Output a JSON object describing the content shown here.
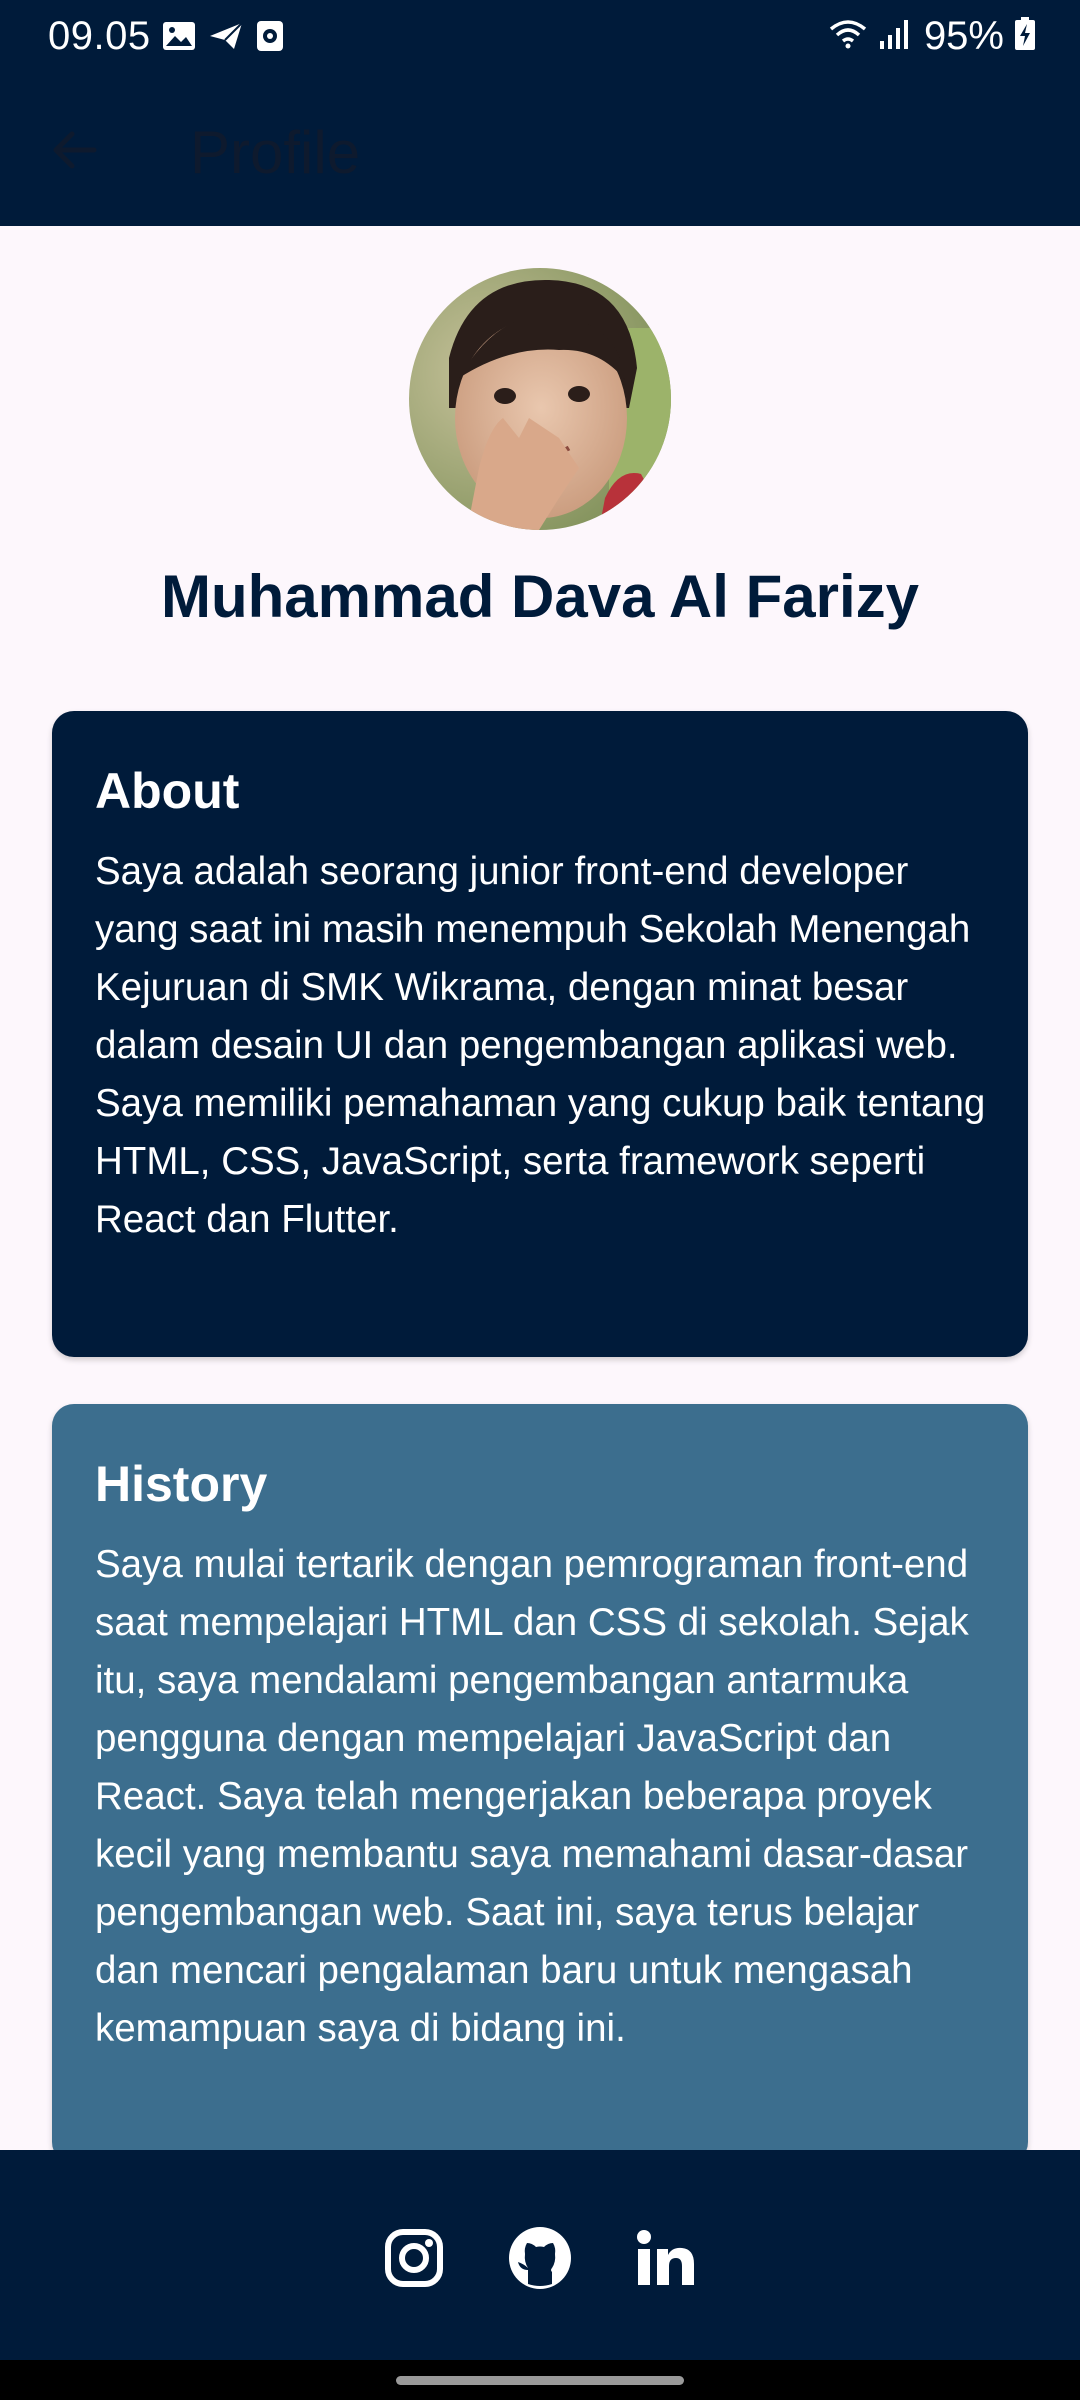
{
  "status_bar": {
    "time": "09.05",
    "battery": "95%",
    "left_icons": [
      "gallery-icon",
      "send-icon",
      "screen-record-icon"
    ],
    "right_icons": [
      "wifi-icon",
      "signal-icon",
      "battery-charging-icon"
    ]
  },
  "app_bar": {
    "title": "Profile",
    "back_icon": "arrow-back-icon"
  },
  "profile": {
    "name": "Muhammad Dava Al Farizy"
  },
  "cards": {
    "about": {
      "title": "About",
      "body": "Saya adalah seorang junior front-end developer yang saat ini masih menempuh Sekolah Menengah Kejuruan di SMK Wikrama, dengan minat besar dalam desain UI dan pengembangan aplikasi web. Saya memiliki pemahaman yang cukup baik tentang HTML, CSS, JavaScript, serta framework seperti React dan Flutter."
    },
    "history": {
      "title": "History",
      "body": "Saya mulai tertarik dengan pemrograman front-end saat mempelajari HTML dan CSS di sekolah. Sejak itu, saya mendalami pengembangan antarmuka pengguna dengan mempelajari JavaScript dan React. Saya telah mengerjakan beberapa proyek kecil yang membantu saya memahami dasar-dasar pengembangan web. Saat ini, saya terus belajar dan mencari pengalaman baru untuk mengasah kemampuan saya di bidang ini."
    }
  },
  "social": [
    "instagram-icon",
    "github-icon",
    "linkedin-icon"
  ],
  "colors": {
    "primary": "#001B3A",
    "secondary": "#3C6E8E",
    "background": "#FDF7FC",
    "on_primary": "#FFFFFF"
  }
}
